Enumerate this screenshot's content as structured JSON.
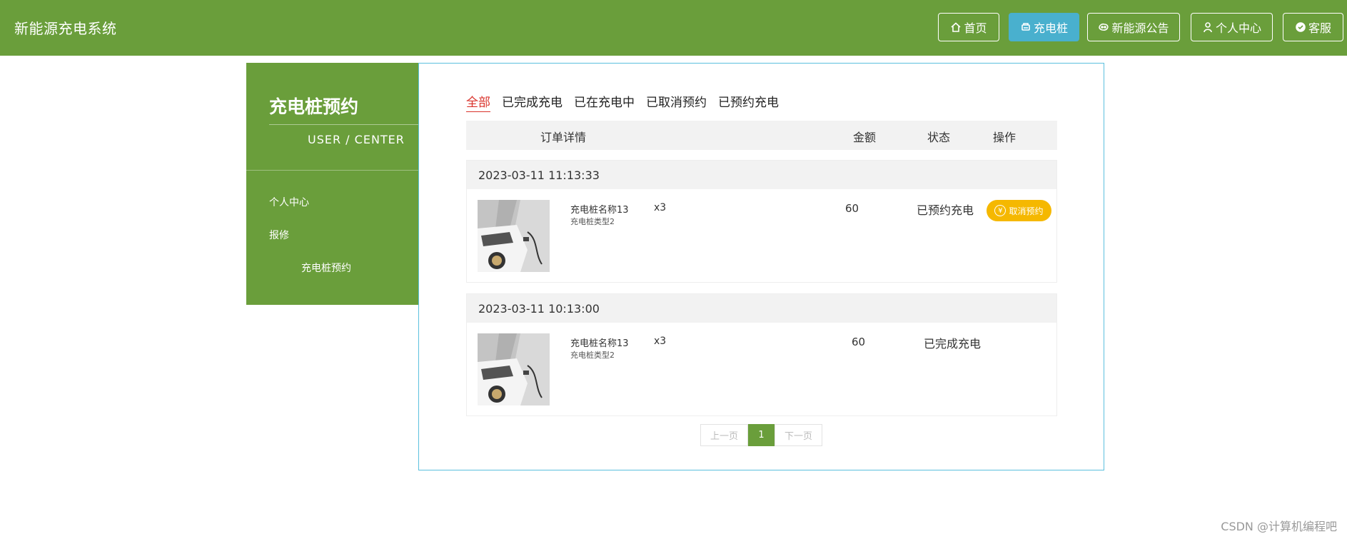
{
  "brand": "新能源充电系统",
  "nav": [
    {
      "label": "首页",
      "icon": "home-icon"
    },
    {
      "label": "充电桩",
      "icon": "charger-icon"
    },
    {
      "label": "新能源公告",
      "icon": "announcement-icon"
    },
    {
      "label": "个人中心",
      "icon": "user-icon"
    },
    {
      "label": "客服",
      "icon": "chat-icon"
    }
  ],
  "sidebar": {
    "title": "充电桩预约",
    "subtitle": "USER / CENTER",
    "items": [
      "个人中心",
      "报修",
      "充电桩预约"
    ]
  },
  "tabs": [
    "全部",
    "已完成充电",
    "已在充电中",
    "已取消预约",
    "已预约充电"
  ],
  "table_headers": {
    "detail": "订单详情",
    "amount": "金额",
    "status": "状态",
    "action": "操作"
  },
  "orders": [
    {
      "time": "2023-03-11 11:13:33",
      "name": "充电桩名称13",
      "type": "充电桩类型2",
      "qty": "x3",
      "amount": "60",
      "status": "已预约充电",
      "action": "取消预约"
    },
    {
      "time": "2023-03-11 10:13:00",
      "name": "充电桩名称13",
      "type": "充电桩类型2",
      "qty": "x3",
      "amount": "60",
      "status": "已完成充电"
    }
  ],
  "pagination": {
    "prev": "上一页",
    "current": "1",
    "next": "下一页"
  },
  "watermark": "CSDN @计算机编程吧",
  "colors": {
    "primary_green": "#6a9e3b",
    "active_nav": "#49b0ce",
    "panel_border": "#5bc0de",
    "tab_active": "#d9322b",
    "cancel_button": "#f5b800"
  }
}
